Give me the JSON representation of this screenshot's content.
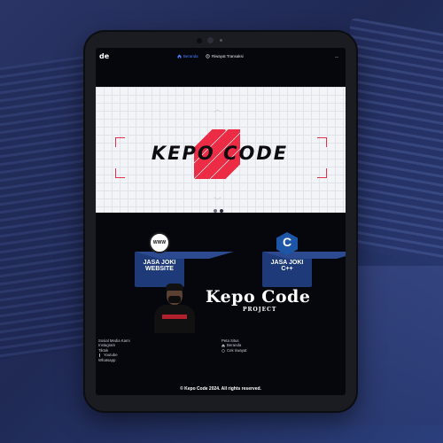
{
  "nav": {
    "logo": "de",
    "items": [
      {
        "label": "Beranda",
        "icon": "home-icon",
        "active": true
      },
      {
        "label": "Riwayat Transaksi",
        "icon": "history-icon",
        "active": false
      }
    ]
  },
  "banner": {
    "brand": "KEPO CODE",
    "slide_count": 2,
    "active_slide": 2
  },
  "services": [
    {
      "title_line1": "JASA JOKI",
      "title_line2": "WEBSITE",
      "icon": "globe-icon",
      "icon_text": "WWW"
    },
    {
      "title_line1": "JASA JOKI",
      "title_line2": "C++",
      "icon": "cpp-icon",
      "icon_text": "C"
    }
  ],
  "promo": {
    "title": "Kepo Code",
    "subtitle": "PROJECT"
  },
  "footer": {
    "social_heading": "Sosial Media Kami",
    "social_links": [
      "Instagram",
      "Tiktok",
      "Youtube",
      "Whatsapp"
    ],
    "site_heading": "Peta Situs",
    "site_links": [
      {
        "label": "Beranda",
        "icon": "home-icon"
      },
      {
        "label": "Cek riwayat",
        "icon": "history-icon"
      }
    ],
    "copyright": "© Kepo Code 2024. All rights reserved."
  },
  "colors": {
    "accent": "#4d7dff",
    "brand_red": "#ec2b44",
    "service_blue": "#1f3a78",
    "page_bg": "#06070d"
  }
}
